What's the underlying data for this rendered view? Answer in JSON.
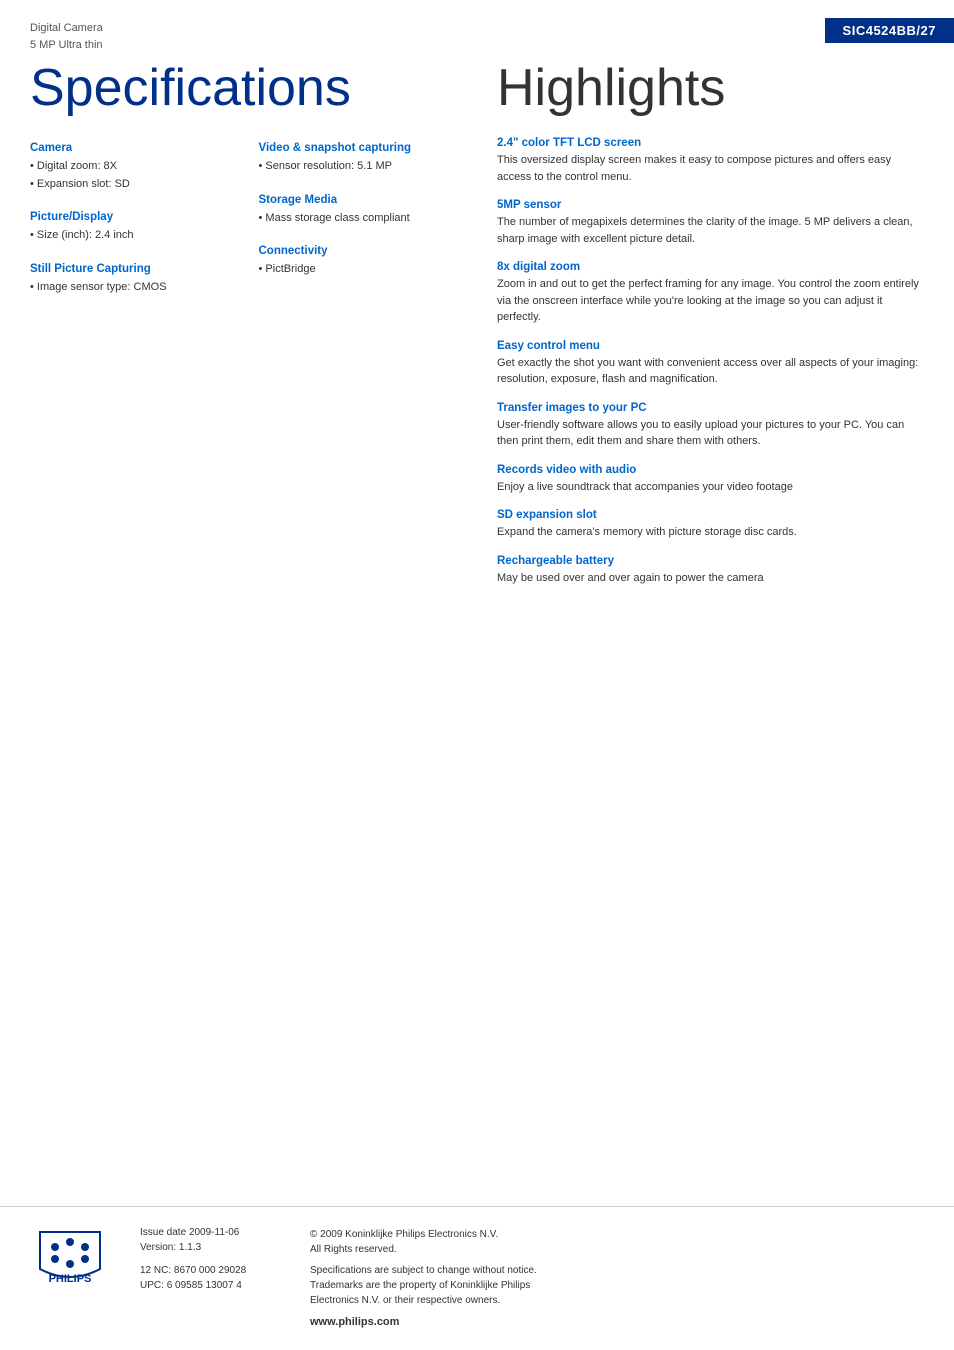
{
  "header": {
    "product_type": "Digital Camera",
    "product_subtitle": "5 MP Ultra thin",
    "model_number": "SIC4524BB/27"
  },
  "specs": {
    "title": "Specifications",
    "left_sections": [
      {
        "title": "Camera",
        "items": [
          "Digital zoom: 8X",
          "Expansion slot: SD"
        ]
      },
      {
        "title": "Picture/Display",
        "items": [
          "Size (inch): 2.4 inch"
        ]
      },
      {
        "title": "Still Picture Capturing",
        "items": [
          "Image sensor type: CMOS"
        ]
      }
    ],
    "right_sections": [
      {
        "title": "Video & snapshot capturing",
        "items": [
          "Sensor resolution: 5.1 MP"
        ]
      },
      {
        "title": "Storage Media",
        "items": [
          "Mass storage class compliant"
        ]
      },
      {
        "title": "Connectivity",
        "items": [
          "PictBridge"
        ]
      }
    ]
  },
  "highlights": {
    "title": "Highlights",
    "items": [
      {
        "title": "2.4\" color TFT LCD screen",
        "desc": "This oversized display screen makes it easy to compose pictures and offers easy access to the control menu."
      },
      {
        "title": "5MP sensor",
        "desc": "The number of megapixels determines the clarity of the image. 5 MP delivers a clean, sharp image with excellent picture detail."
      },
      {
        "title": "8x digital zoom",
        "desc": "Zoom in and out to get the perfect framing for any image. You control the zoom entirely via the onscreen interface while you're looking at the image so you can adjust it perfectly."
      },
      {
        "title": "Easy control menu",
        "desc": "Get exactly the shot you want with convenient access over all aspects of your imaging: resolution, exposure, flash and magnification."
      },
      {
        "title": "Transfer images to your PC",
        "desc": "User-friendly software allows you to easily upload your pictures to your PC. You can then print them, edit them and share them with others."
      },
      {
        "title": "Records video with audio",
        "desc": "Enjoy a live soundtrack that accompanies your video footage"
      },
      {
        "title": "SD expansion slot",
        "desc": "Expand the camera's memory with picture storage disc cards."
      },
      {
        "title": "Rechargeable battery",
        "desc": "May be used over and over again to power the camera"
      }
    ]
  },
  "footer": {
    "issue_date_label": "Issue date",
    "issue_date": "2009-11-06",
    "version_label": "Version:",
    "version": "1.1.3",
    "nc_label": "12 NC:",
    "nc_value": "8670 000 29028",
    "upc_label": "UPC:",
    "upc_value": "6 09585 13007 4",
    "copyright": "© 2009 Koninklijke Philips Electronics N.V.\nAll Rights reserved.",
    "legal": "Specifications are subject to change without notice.\nTrademarks are the property of Koninklijke Philips\nElectronics N.V. or their respective owners.",
    "website": "www.philips.com"
  }
}
